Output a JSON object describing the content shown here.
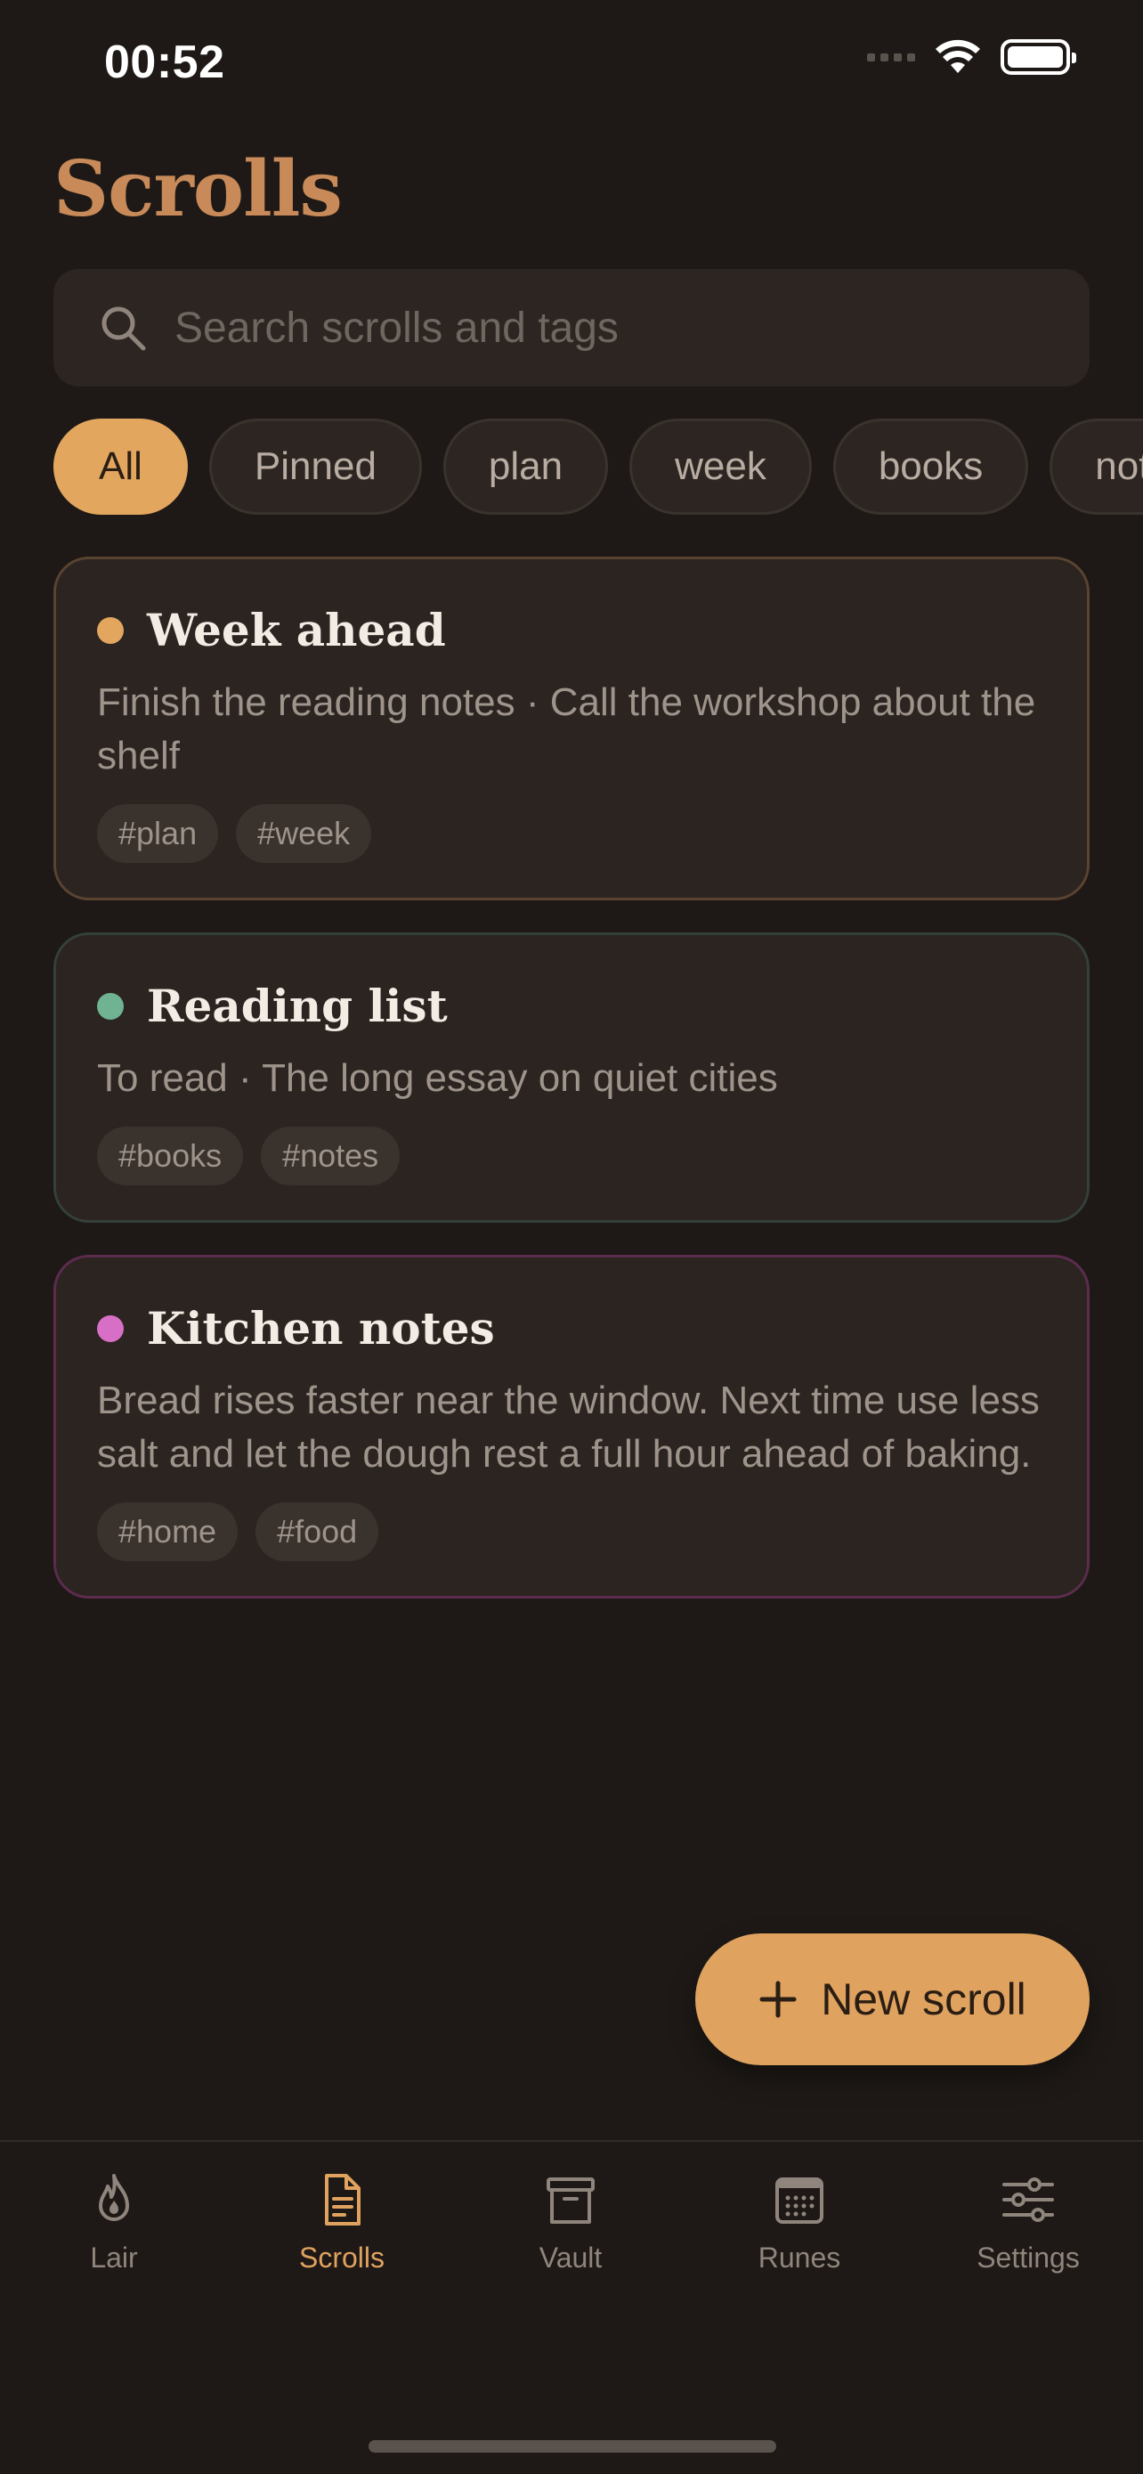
{
  "status_bar": {
    "time": "00:52"
  },
  "page": {
    "title": "Scrolls"
  },
  "search": {
    "placeholder": "Search scrolls and tags"
  },
  "chips": [
    "All",
    "Pinned",
    "plan",
    "week",
    "books",
    "notes"
  ],
  "scrolls": [
    {
      "title": "Week ahead",
      "body": "Finish the reading notes · Call the workshop about the shelf",
      "tags": [
        "#plan",
        "#week"
      ],
      "color": "#e2a65f"
    },
    {
      "title": "Reading list",
      "body": "To read · The long essay on quiet cities",
      "tags": [
        "#books",
        "#notes"
      ],
      "color": "#6fb392"
    },
    {
      "title": "Kitchen notes",
      "body": "Bread rises faster near the window. Next time use less salt and let the dough rest a full hour ahead of baking.",
      "tags": [
        "#home",
        "#food"
      ],
      "color": "#d86fc6"
    }
  ],
  "fab": {
    "label": "New scroll",
    "icon": "plus-icon"
  },
  "tabbar": {
    "items": [
      {
        "label": "Lair",
        "icon": "flame-icon"
      },
      {
        "label": "Scrolls",
        "icon": "document-icon"
      },
      {
        "label": "Vault",
        "icon": "archive-box-icon"
      },
      {
        "label": "Runes",
        "icon": "calendar-grid-icon"
      },
      {
        "label": "Settings",
        "icon": "sliders-icon"
      }
    ],
    "active": "Scrolls"
  },
  "colors": {
    "background": "#1e1916",
    "accent": "#e0a25f",
    "title": "#c88a58"
  }
}
